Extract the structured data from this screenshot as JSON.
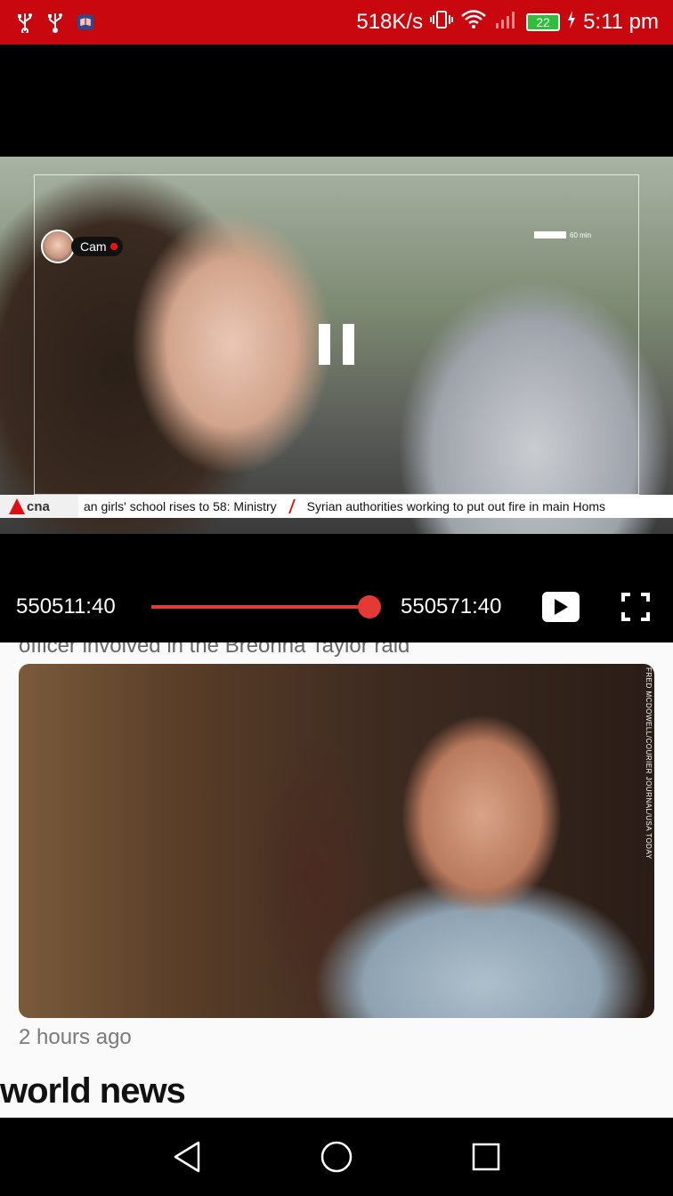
{
  "status_bar": {
    "network_speed": "518K/s",
    "battery_level": "22",
    "time": "5:11 pm",
    "icons": [
      "usb-icon",
      "usb-icon",
      "app-notification-icon",
      "vibrate-icon",
      "wifi-icon",
      "signal-icon",
      "battery-icon",
      "charging-icon"
    ]
  },
  "video": {
    "cam_label": "Cam",
    "ticker_logo": "cna",
    "ticker_items": [
      "an girls' school rises to 58: Ministry",
      "Syrian authorities working to put out fire in main Homs"
    ],
    "hud_text": "60 min",
    "current_time": "550511:40",
    "duration": "550571:40",
    "progress": 0.94
  },
  "feed": {
    "cut_headline": "officer involved in the Breonna Taylor raid",
    "image_credit": "FRED MCDOWELL/COURIER JOURNAL/USA TODAY",
    "timestamp": "2 hours ago",
    "section_title": "world news"
  },
  "colors": {
    "status_bar": "#c8070f",
    "accent": "#e53935",
    "player_bg": "#000000"
  }
}
